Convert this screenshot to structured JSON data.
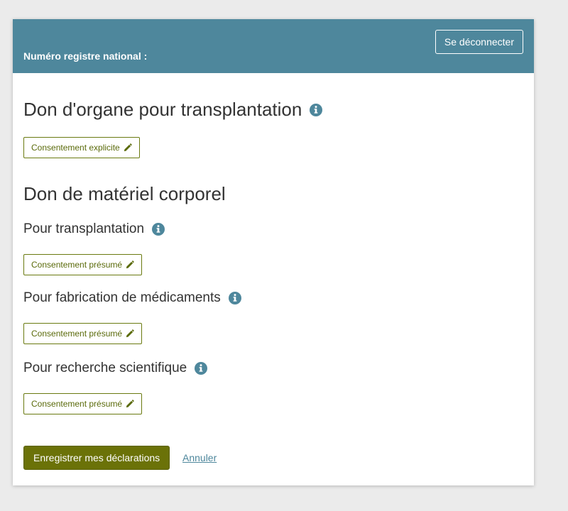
{
  "header": {
    "registry_label": "Numéro registre national :",
    "logout_label": "Se déconnecter",
    "background_color": "#4e879c"
  },
  "organ_donation": {
    "title": "Don d'organe pour transplantation",
    "consent_label": "Consentement explicite"
  },
  "body_material": {
    "title": "Don de matériel corporel",
    "sections": [
      {
        "title": "Pour transplantation",
        "consent_label": "Consentement présumé"
      },
      {
        "title": "Pour fabrication de médicaments",
        "consent_label": "Consentement présumé"
      },
      {
        "title": "Pour recherche scientifique",
        "consent_label": "Consentement présumé"
      }
    ]
  },
  "actions": {
    "save_label": "Enregistrer mes déclarations",
    "cancel_label": "Annuler",
    "accent_color": "#6b7208"
  },
  "icons": {
    "info": "info-icon",
    "edit": "pencil-icon"
  }
}
